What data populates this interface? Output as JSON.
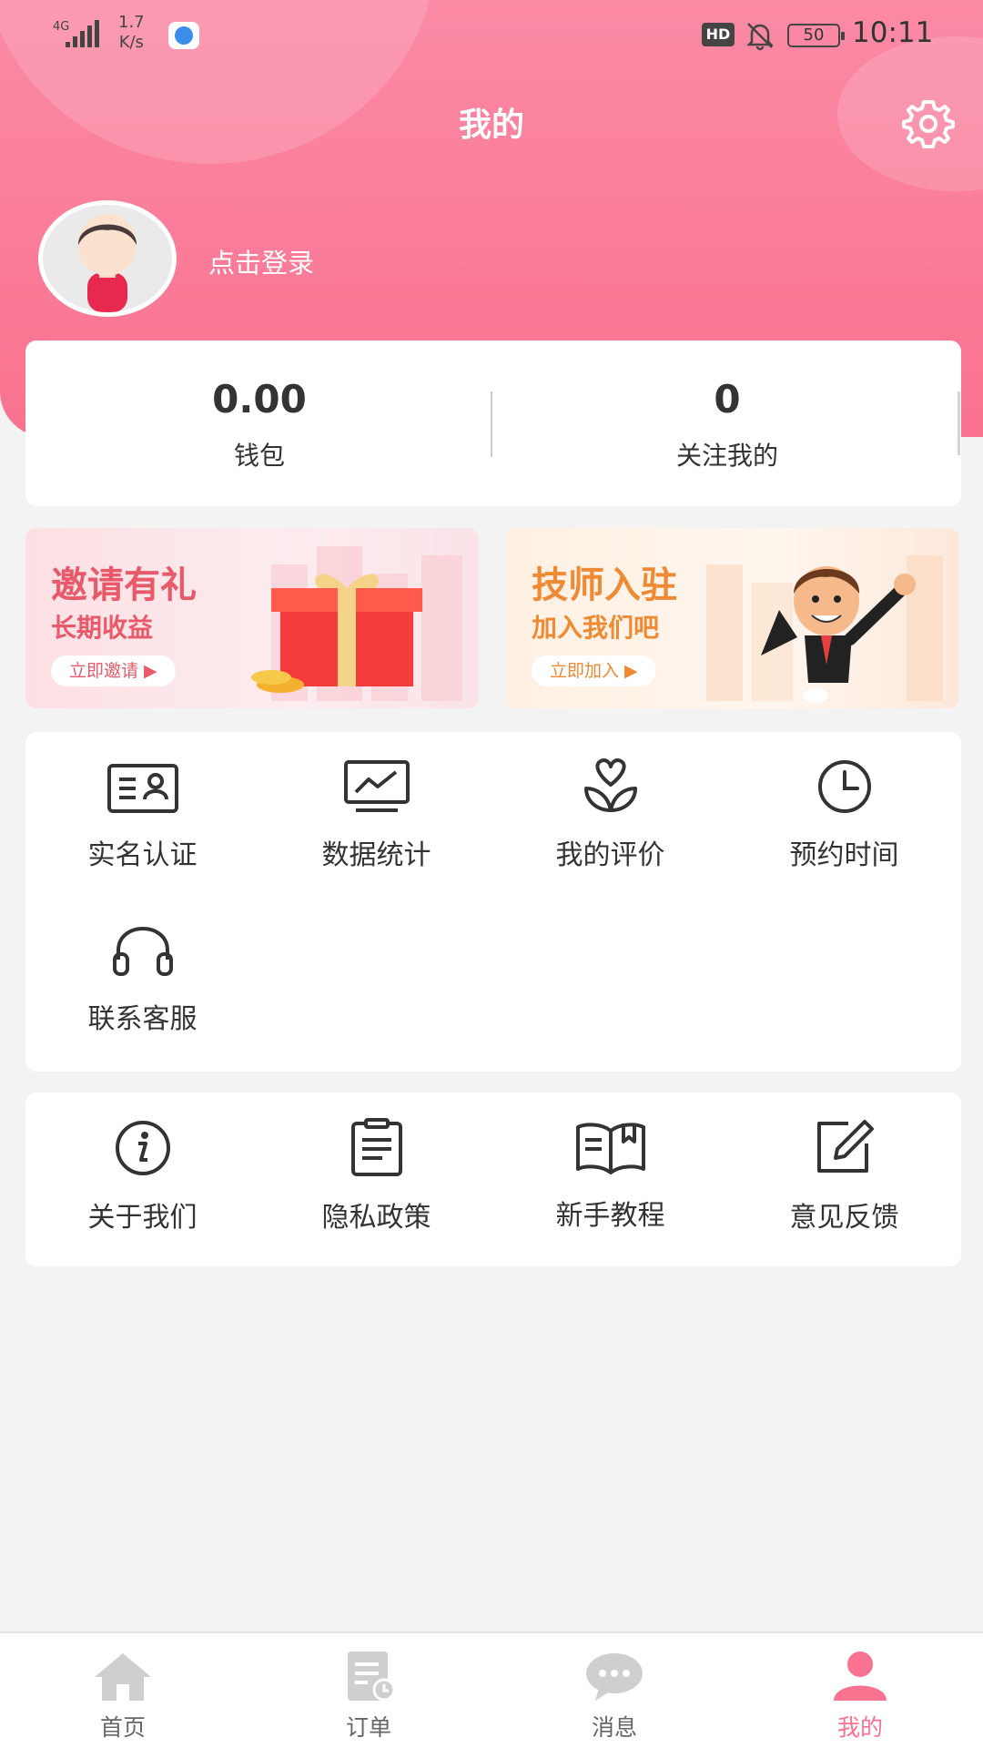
{
  "status_bar": {
    "network": "4G",
    "speed_value": "1.7",
    "speed_unit": "K/s",
    "hd": "HD",
    "battery": "50",
    "time": "10:11"
  },
  "header": {
    "title": "我的",
    "login_text": "点击登录"
  },
  "stats": {
    "wallet_value": "0.00",
    "wallet_label": "钱包",
    "followers_value": "0",
    "followers_label": "关注我的"
  },
  "banners": {
    "invite": {
      "title": "邀请有礼",
      "subtitle": "长期收益",
      "button": "立即邀请 ▶"
    },
    "technician": {
      "title": "技师入驻",
      "subtitle": "加入我们吧",
      "button": "立即加入 ▶"
    }
  },
  "features": [
    {
      "label": "实名认证",
      "icon": "id-card-icon"
    },
    {
      "label": "数据统计",
      "icon": "chart-icon"
    },
    {
      "label": "我的评价",
      "icon": "heart-flower-icon"
    },
    {
      "label": "预约时间",
      "icon": "clock-icon"
    },
    {
      "label": "联系客服",
      "icon": "headset-icon"
    }
  ],
  "about": [
    {
      "label": "关于我们",
      "icon": "info-icon"
    },
    {
      "label": "隐私政策",
      "icon": "document-icon"
    },
    {
      "label": "新手教程",
      "icon": "book-icon"
    },
    {
      "label": "意见反馈",
      "icon": "edit-icon"
    }
  ],
  "bottom_nav": [
    {
      "label": "首页",
      "icon": "home-icon"
    },
    {
      "label": "订单",
      "icon": "order-icon"
    },
    {
      "label": "消息",
      "icon": "message-icon"
    },
    {
      "label": "我的",
      "icon": "profile-icon",
      "active": true
    }
  ],
  "colors": {
    "accent": "#f9728f",
    "invite": "#e8596a",
    "technician": "#ef8a34"
  }
}
